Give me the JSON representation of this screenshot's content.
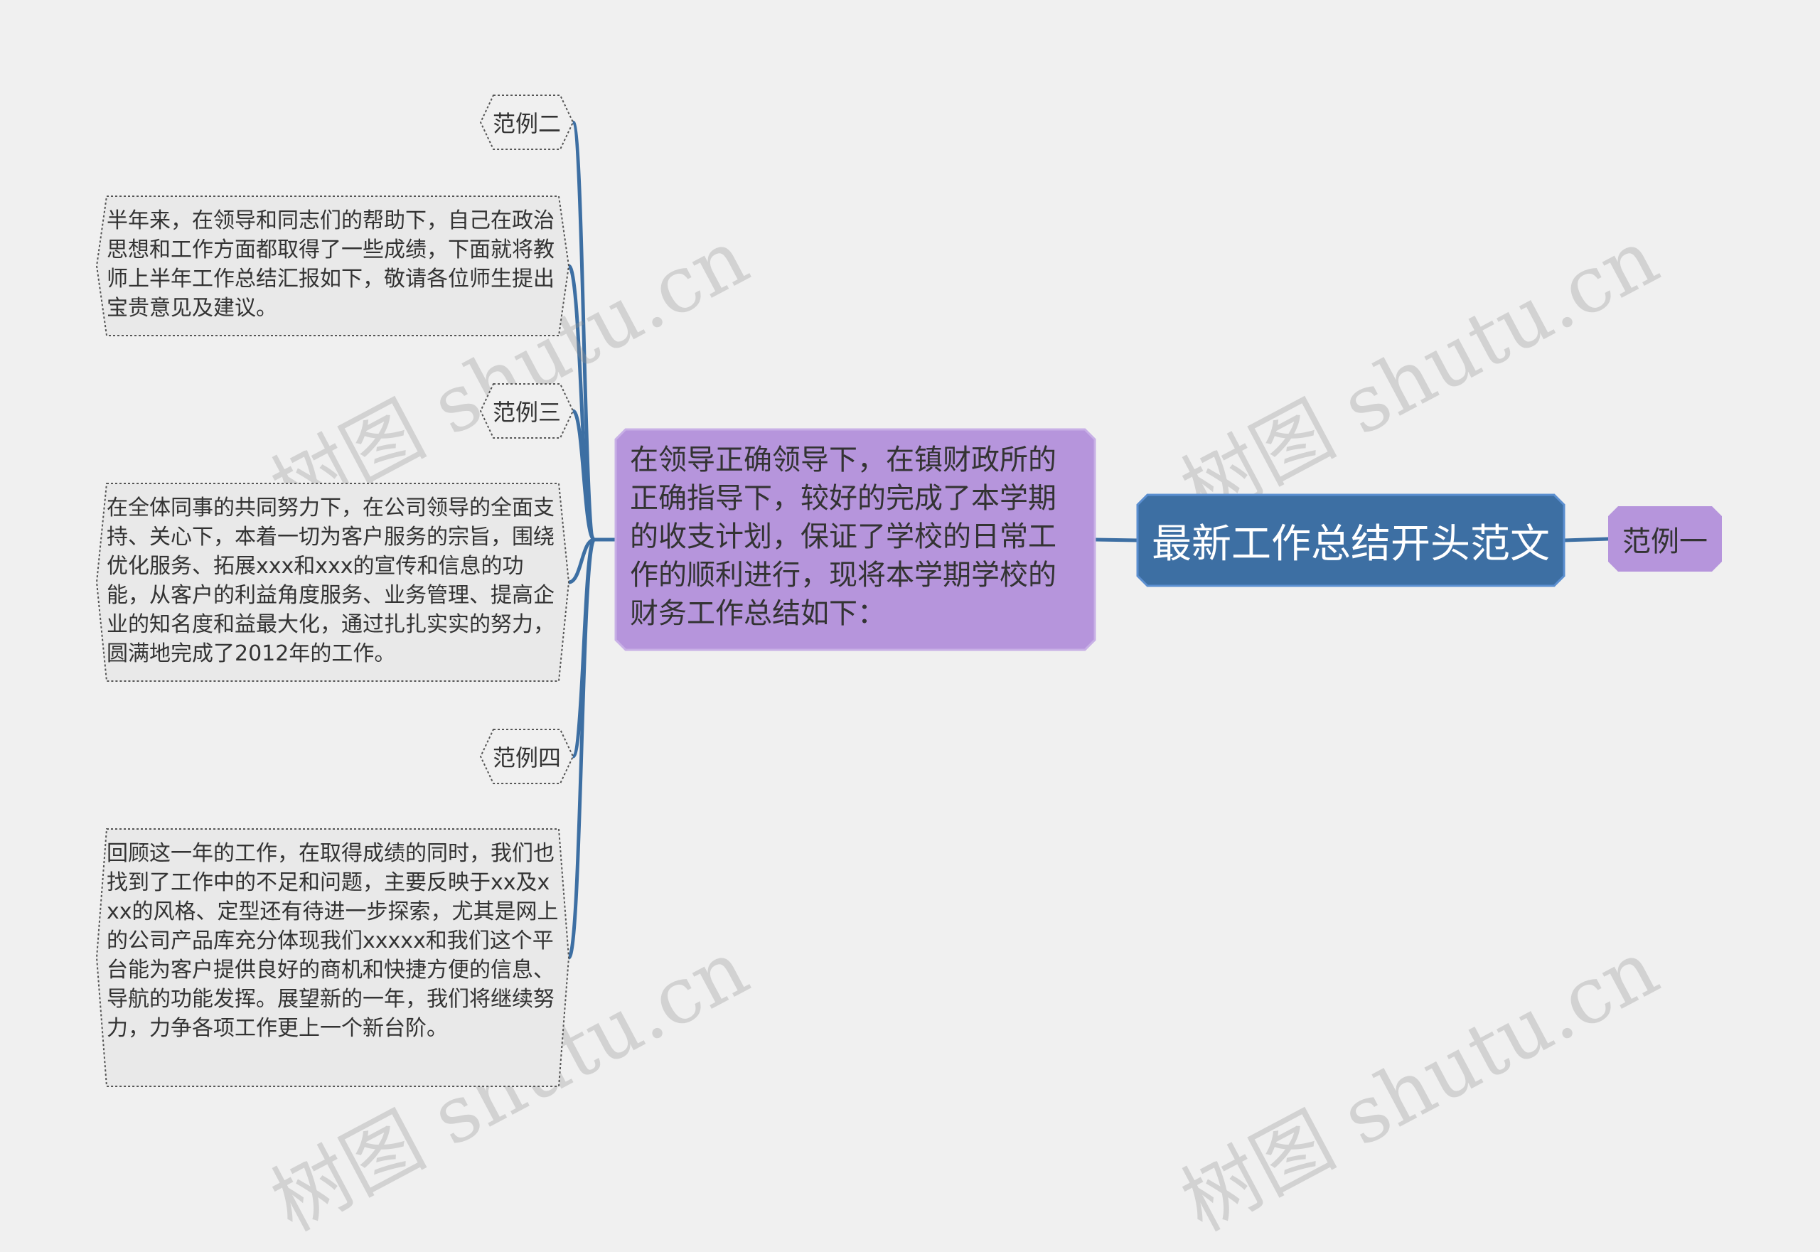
{
  "root": {
    "label": "最新工作总结开头范文"
  },
  "center": {
    "text": "在领导正确领导下，在镇财政所的正确指导下，较好的完成了本学期的收支计划，保证了学校的日常工作的顺利进行，现将本学期学校的财务工作总结如下："
  },
  "right_child": {
    "label": "范例一"
  },
  "left_children": [
    {
      "kind": "label",
      "text": "范例二"
    },
    {
      "kind": "text",
      "text": "半年来，在领导和同志们的帮助下，自己在政治思想和工作方面都取得了一些成绩，下面就将教师上半年工作总结汇报如下，敬请各位师生提出宝贵意见及建议。"
    },
    {
      "kind": "label",
      "text": "范例三"
    },
    {
      "kind": "text",
      "text": "在全体同事的共同努力下，在公司领导的全面支持、关心下，本着一切为客户服务的宗旨，围绕优化服务、拓展xxx和xxx的宣传和信息的功能，从客户的利益角度服务、业务管理、提高企业的知名度和益最大化，通过扎扎实实的努力，圆满地完成了2012年的工作。"
    },
    {
      "kind": "label",
      "text": "范例四"
    },
    {
      "kind": "text",
      "text": "回顾这一年的工作，在取得成绩的同时，我们也找到了工作中的不足和问题，主要反映于xx及xxx的风格、定型还有待进一步探索，尤其是网上的公司产品库充分体现我们xxxxx和我们这个平台能为客户提供良好的商机和快捷方便的信息、导航的功能发挥。展望新的一年，我们将继续努力，力争各项工作更上一个新台阶。"
    }
  ],
  "watermark": "树图 shutu.cn",
  "colors": {
    "background": "#f0f0f0",
    "root_fill": "#3d6fa3",
    "root_stroke": "#5b8fd0",
    "center_fill": "#b695dc",
    "center_stroke": "#c8b0e6",
    "child_fill": "#b695dc",
    "connector": "#3d6fa3",
    "label_fill": "#f0f0f0",
    "text_box_fill": "#e9e9e9",
    "dotted_stroke": "#555555"
  }
}
